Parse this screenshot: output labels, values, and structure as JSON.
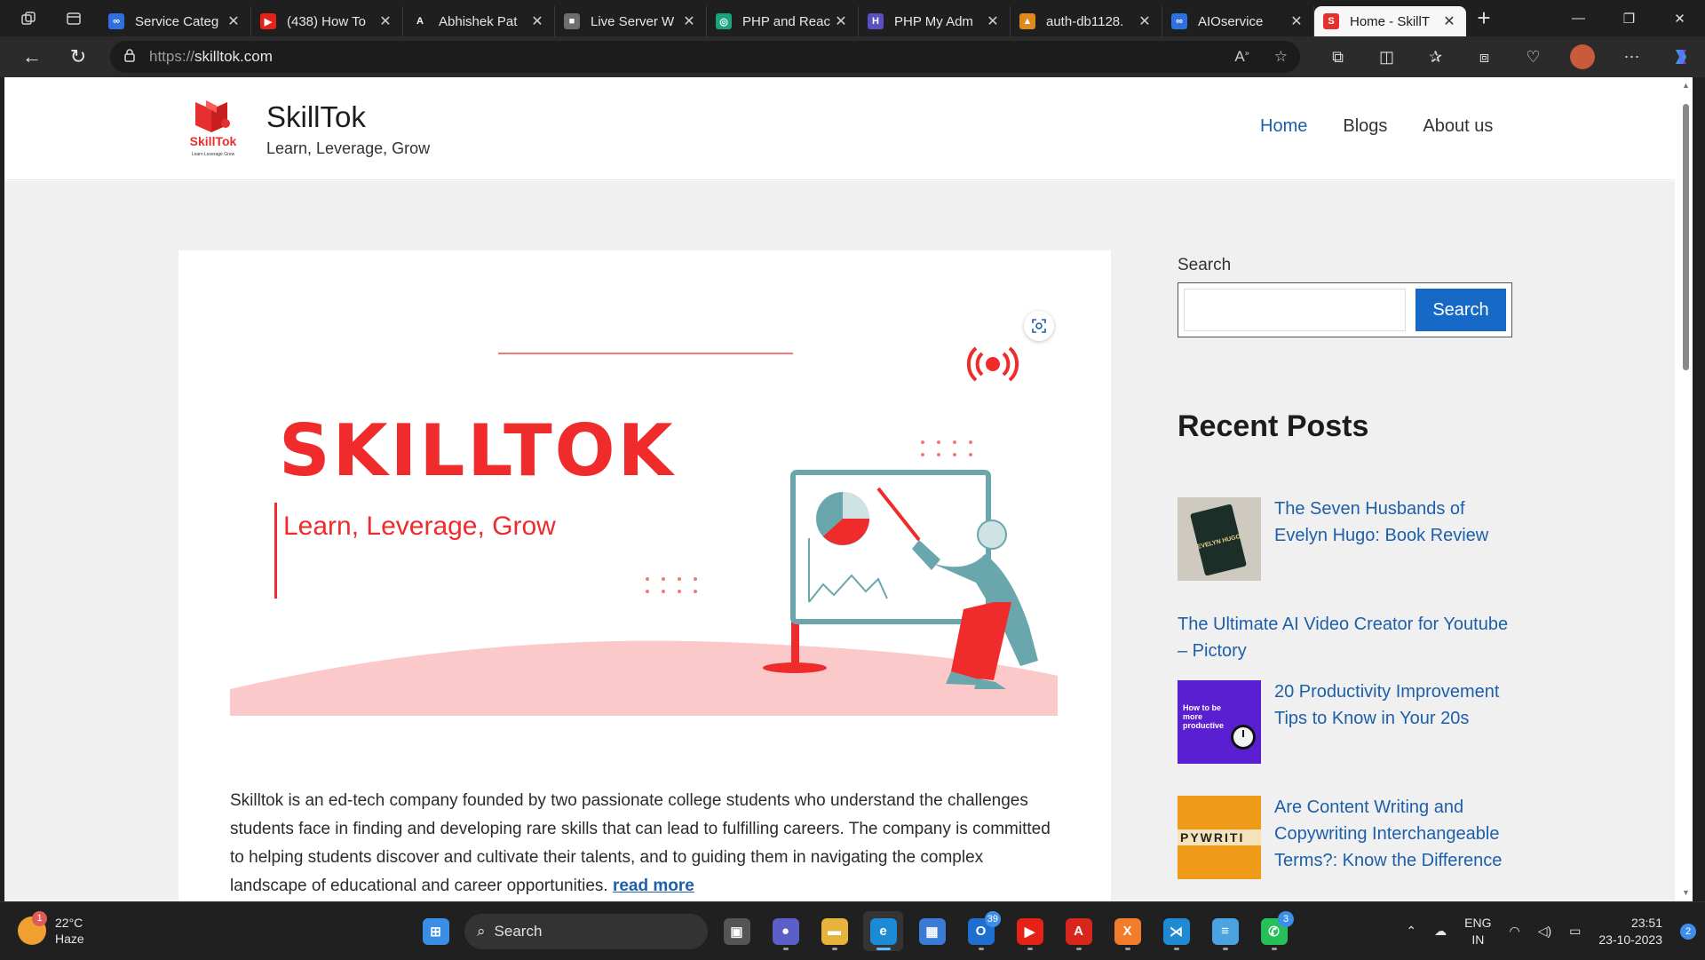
{
  "browser": {
    "tabs": [
      {
        "title": "Service Categ",
        "favicon_color": "#2f6fe0",
        "favicon_glyph": "∞"
      },
      {
        "title": "(438) How To",
        "favicon_color": "#e62117",
        "favicon_glyph": "▶"
      },
      {
        "title": "Abhishek Pat",
        "favicon_color": "#1f1f1f",
        "favicon_glyph": "A"
      },
      {
        "title": "Live Server W",
        "favicon_color": "#6e6e6e",
        "favicon_glyph": "■"
      },
      {
        "title": "PHP and Reac",
        "favicon_color": "#19a37f",
        "favicon_glyph": "◎"
      },
      {
        "title": "PHP My Adm",
        "favicon_color": "#5b4fc4",
        "favicon_glyph": "H"
      },
      {
        "title": "auth-db1128.",
        "favicon_color": "#e08a1e",
        "favicon_glyph": "▲"
      },
      {
        "title": "AIOservice",
        "favicon_color": "#2f6fe0",
        "favicon_glyph": "∞"
      },
      {
        "title": "Home - SkillT",
        "favicon_color": "#e63030",
        "favicon_glyph": "S"
      }
    ],
    "url_proto": "https://",
    "url_host": "skilltok.com"
  },
  "site": {
    "brand_title": "SkillTok",
    "brand_tagline": "Learn, Leverage, Grow",
    "logo_text": "SkillTok",
    "logo_subtext": "Learn Leverage Grow",
    "nav": [
      {
        "label": "Home",
        "current": true
      },
      {
        "label": "Blogs",
        "current": false
      },
      {
        "label": "About us",
        "current": false
      }
    ]
  },
  "hero": {
    "title": "SKILLTOK",
    "subtitle": "Learn, Leverage, Grow",
    "accent_color": "#ef2b2b",
    "teal_color": "#6aa7ad"
  },
  "article": {
    "body": "Skilltok is an ed-tech company founded by two passionate college students who understand the challenges students face in finding and developing rare skills that can lead to fulfilling careers. The company is committed to helping students discover and cultivate their talents, and to guiding them in navigating the complex landscape of educational and career opportunities.",
    "read_more": "read more"
  },
  "sidebar": {
    "search_label": "Search",
    "search_value": "",
    "search_button": "Search",
    "recent_heading": "Recent Posts",
    "posts": [
      {
        "title_lines": [
          "The Seven Husbands of",
          "Evelyn Hugo: Book Review"
        ],
        "thumb": "book",
        "thumb_text": "EVELYN HUGO"
      },
      {
        "title_lines": [
          "The Ultimate AI Video Creator for Youtube",
          "– Pictory"
        ],
        "thumb": "none",
        "thumb_text": ""
      },
      {
        "title_lines": [
          "20 Productivity Improvement",
          "Tips to Know in Your 20s"
        ],
        "thumb": "purple",
        "thumb_text": "How to be more productive"
      },
      {
        "title_lines": [
          "Are Content Writing and",
          "Copywriting Interchangeable",
          "Terms?: Know the Difference"
        ],
        "thumb": "orange",
        "thumb_text": "PYWRITI"
      }
    ]
  },
  "taskbar": {
    "weather_temp": "22°C",
    "weather_desc": "Haze",
    "weather_badge": "1",
    "search_label": "Search",
    "apps": [
      {
        "name": "start",
        "color": "#3a8ee6",
        "glyph": "⊞"
      },
      {
        "name": "task-view",
        "color": "#555555",
        "glyph": "▣"
      },
      {
        "name": "meet",
        "color": "#5b5fc7",
        "glyph": "●"
      },
      {
        "name": "file-explorer",
        "color": "#e8b33a",
        "glyph": "▬"
      },
      {
        "name": "edge",
        "color": "#1b8bd6",
        "glyph": "e"
      },
      {
        "name": "store",
        "color": "#3a7bd5",
        "glyph": "▦"
      },
      {
        "name": "outlook",
        "color": "#1f6fd1",
        "glyph": "O",
        "badge": "39"
      },
      {
        "name": "youtube",
        "color": "#e62117",
        "glyph": "▶"
      },
      {
        "name": "acrobat",
        "color": "#d9261c",
        "glyph": "A"
      },
      {
        "name": "xampp",
        "color": "#f37c2a",
        "glyph": "X"
      },
      {
        "name": "vscode",
        "color": "#1f8ad2",
        "glyph": "⋊"
      },
      {
        "name": "notepad",
        "color": "#4aa3e0",
        "glyph": "≡"
      },
      {
        "name": "whatsapp",
        "color": "#25c05a",
        "glyph": "✆",
        "badge": "3"
      }
    ],
    "language_top": "ENG",
    "language_bottom": "IN",
    "time": "23:51",
    "date": "23-10-2023",
    "notifications": "2"
  }
}
